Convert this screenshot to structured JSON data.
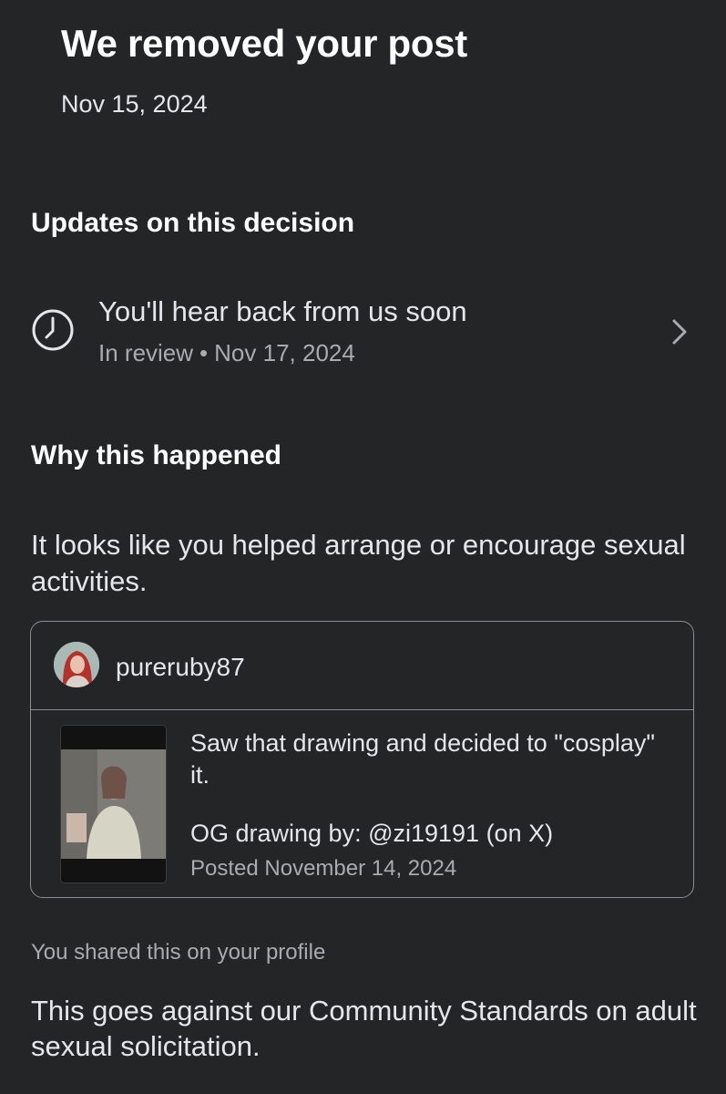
{
  "header": {
    "title": "We removed your post",
    "date": "Nov 15, 2024"
  },
  "updates": {
    "heading": "Updates on this decision",
    "item": {
      "icon": "clock-icon",
      "title": "You'll hear back from us soon",
      "status": "In review",
      "separator": "•",
      "date": "Nov 17, 2024",
      "chevron": "chevron-right-icon"
    }
  },
  "why": {
    "heading": "Why this happened",
    "reason": "It looks like you helped arrange or encourage sexual activities."
  },
  "post": {
    "username": "pureruby87",
    "caption_line1": "Saw that drawing and decided to \"cosplay\" it.",
    "caption_line2": "OG drawing by: @zi19191 (on X)",
    "posted": "Posted November 14, 2024"
  },
  "shared_note": "You shared this on your profile",
  "standards": "This goes against our Community Standards on adult sexual solicitation.",
  "colors": {
    "background": "#242526",
    "primary_text": "#e4e6eb",
    "secondary_text": "#a8abaf",
    "card_border": "#8a8d91"
  }
}
